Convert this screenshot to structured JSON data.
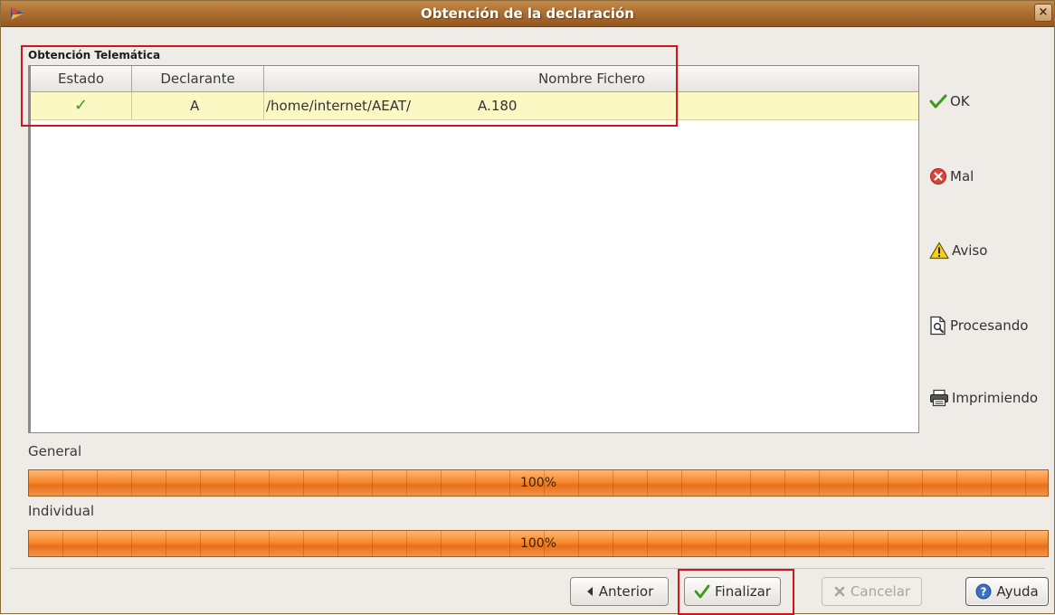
{
  "window": {
    "title": "Obtención de la declaración",
    "close_label": "×"
  },
  "group": {
    "title": "Obtención Telemática"
  },
  "table": {
    "columns": [
      "Estado",
      "Declarante",
      "Nombre Fichero"
    ],
    "rows": [
      {
        "estado": "✓",
        "declarante": "A",
        "fichero_path": "/home/internet/AEAT/",
        "fichero_name": "A.180"
      }
    ]
  },
  "legend": [
    {
      "icon": "check-icon",
      "label": "OK"
    },
    {
      "icon": "error-icon",
      "label": "Mal"
    },
    {
      "icon": "warning-icon",
      "label": "Aviso"
    },
    {
      "icon": "processing-icon",
      "label": "Procesando"
    },
    {
      "icon": "printer-icon",
      "label": "Imprimiendo"
    }
  ],
  "progress": {
    "general": {
      "label": "General",
      "value": 100,
      "text": "100%"
    },
    "individual": {
      "label": "Individual",
      "value": 100,
      "text": "100%"
    }
  },
  "buttons": {
    "anterior": "Anterior",
    "finalizar": "Finalizar",
    "cancelar": "Cancelar",
    "ayuda": "Ayuda"
  },
  "colors": {
    "titlebar": "#a86a2e",
    "progress": "#f68a2e",
    "highlight": "#d2141b",
    "selected_row": "#fbf8c4",
    "ok_green": "#3a9a1a"
  }
}
